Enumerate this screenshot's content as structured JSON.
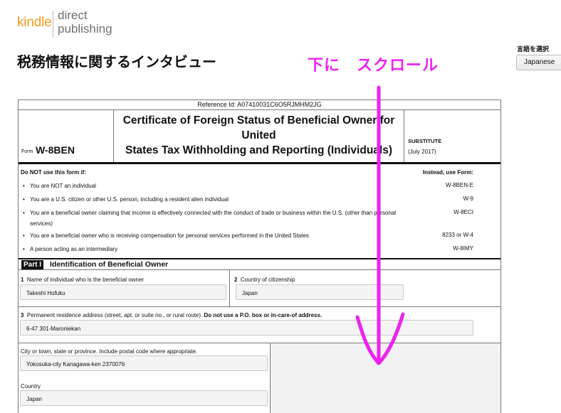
{
  "logo": {
    "kindle": "kindle",
    "direct": "direct",
    "publishing": "publishing"
  },
  "page_title": "税務情報に関するインタビュー",
  "language": {
    "label": "言語を選択",
    "selected": "Japanese"
  },
  "annotation": {
    "text": "下に　スクロール",
    "color": "#ee22ee"
  },
  "form": {
    "reference": "Reference Id: A07410031C6O5RJMHM2JG",
    "form_prefix": "Form",
    "form_name": "W-8BEN",
    "title_lines": [
      "Certificate of Foreign Status of Beneficial Owner for",
      "United",
      "States Tax Withholding and Reporting (Individuals)"
    ],
    "substitute": "SUBSTITUTE",
    "date": "(July 2017)",
    "do_not_use": "Do NOT use this form if:",
    "instead": "Instead, use Form:",
    "bullets": [
      {
        "text": "You are NOT an individual",
        "form": "W-8BEN-E"
      },
      {
        "text": "You are a U.S. citizen or other U.S. person, including a resident alien individual",
        "form": "W-9"
      },
      {
        "text": "You are a beneficial owner claiming that income is effectively connected with the conduct of trade or business within the U.S. (other than personal services)",
        "form": "W-8ECI"
      },
      {
        "text": "You are a beneficial owner who is receiving compensation for personal services performed in the United States",
        "form": "8233 or W-4"
      },
      {
        "text": "A person acting as an intermediary",
        "form": "W-8IMY"
      }
    ],
    "part_badge": "Part I",
    "part_title": "Identification of Beneficial Owner",
    "fields": {
      "name_num": "1",
      "name_label": "Name of individual who is the beneficial owner",
      "name_value": "Takeshi Hofuku",
      "country_num": "2",
      "country_label": "Country of citizenship",
      "country_value": "Japan",
      "address_num": "3",
      "address_label": "Permanent residence address (street, apt. or suite no., or rural route).",
      "address_label_bold": "Do not use a P.O. box or in-care-of address.",
      "address_value": "6-47 301-Maroniekan",
      "city_label": "City or town, state or province. Include postal code where appropriate.",
      "city_value": "Yokosuka-city Kanagawa-ken 2370076",
      "res_country_label": "Country",
      "res_country_value": "Japan"
    }
  }
}
